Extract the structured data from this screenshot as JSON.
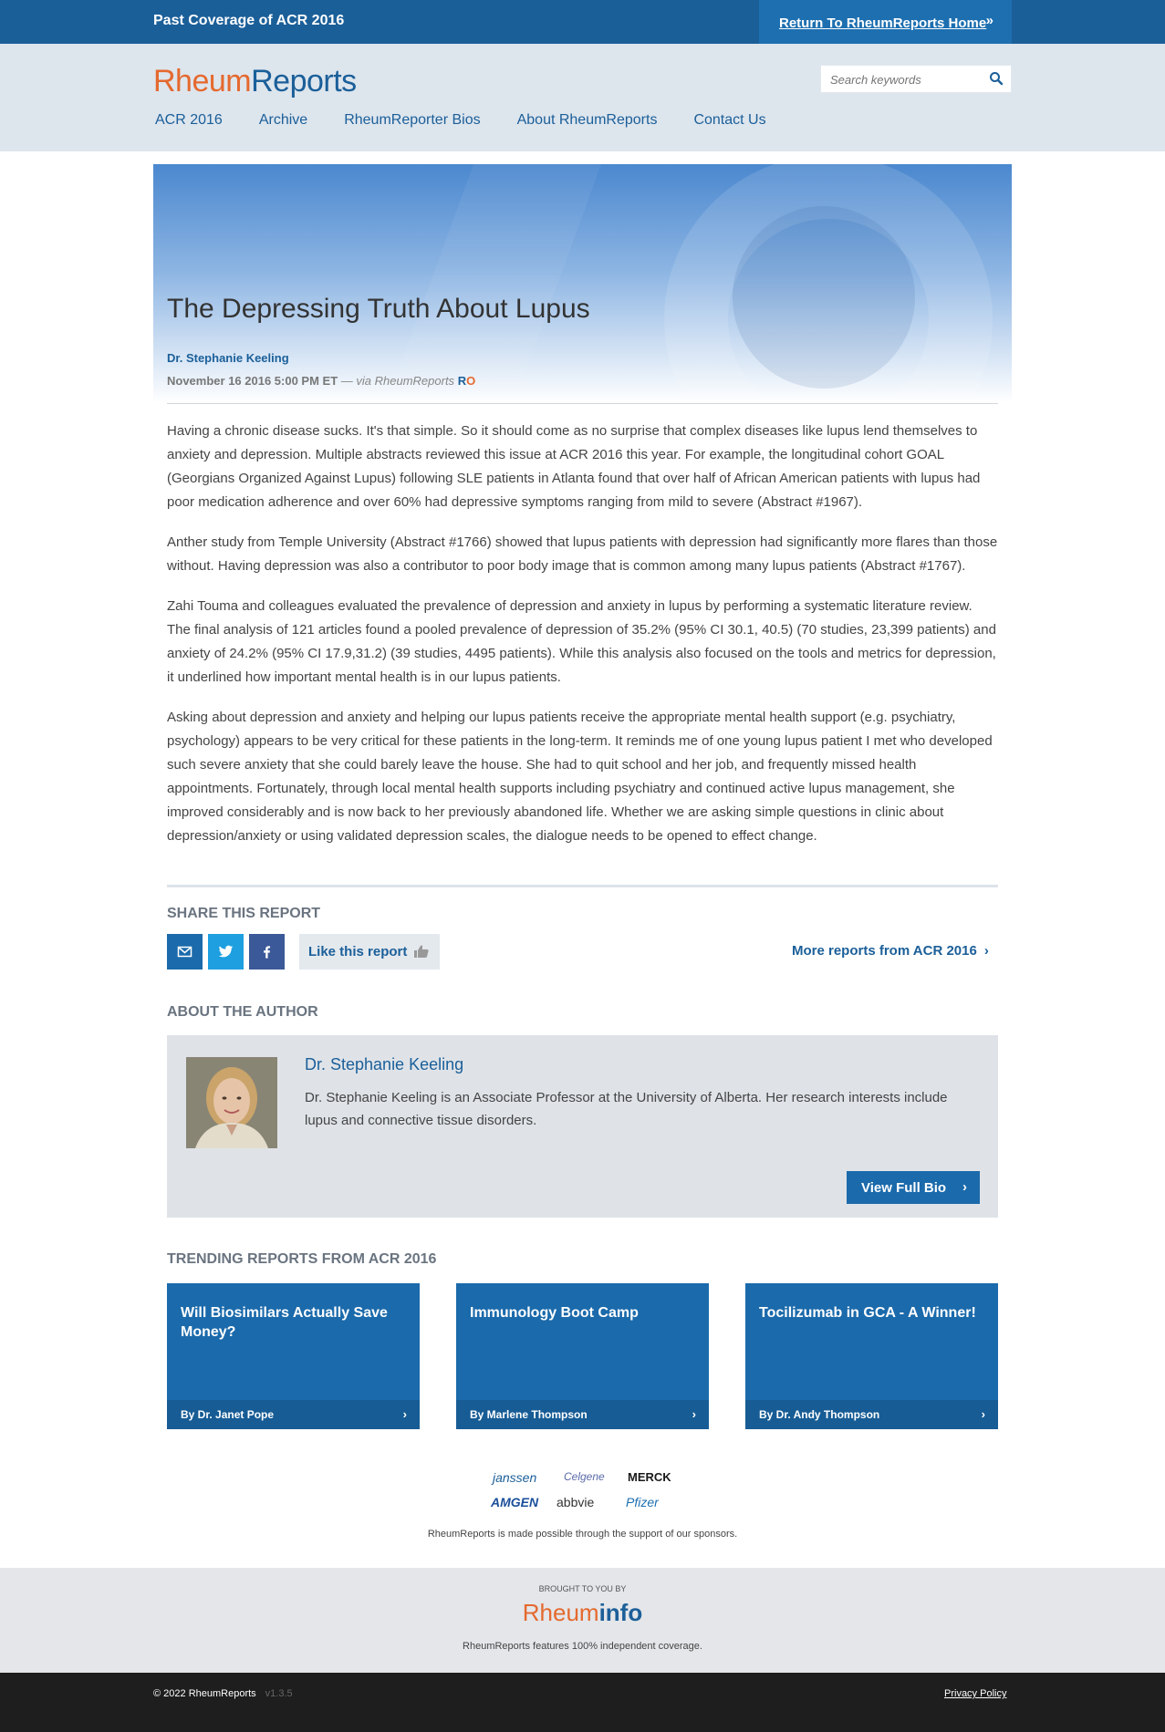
{
  "topbar": {
    "title": "Past Coverage of ACR 2016",
    "return_label": "Return To RheumReports Home",
    "return_icon": "double-chevron-right-icon"
  },
  "header": {
    "logo_part1": "Rheum",
    "logo_part2": "Reports",
    "search_placeholder": "Search keywords",
    "nav": [
      "ACR 2016",
      "Archive",
      "RheumReporter Bios",
      "About RheumReports",
      "Contact Us"
    ]
  },
  "article": {
    "title": "The Depressing Truth About Lupus",
    "author": "Dr. Stephanie Keeling",
    "date": "November 16 2016 5:00 PM ET",
    "via": "— via RheumReports",
    "badge_r": "R",
    "badge_o": "O",
    "paragraphs": [
      "Having a chronic disease sucks. It's that simple. So it should come as no surprise that complex diseases like lupus lend themselves to anxiety and depression. Multiple abstracts reviewed this issue at ACR 2016 this year. For example, the longitudinal cohort GOAL (Georgians Organized Against Lupus) following SLE patients in Atlanta found that over half of African American patients with lupus had poor medication adherence and over 60% had depressive symptoms ranging from mild to severe (Abstract #1967).",
      "Anther study from Temple University (Abstract #1766) showed that lupus patients with depression had significantly more flares than those without. Having depression was also a contributor to poor body image that is common among many lupus patients (Abstract #1767).",
      "Zahi Touma and colleagues evaluated the prevalence of depression and anxiety in lupus by performing a systematic literature review. The final analysis of 121 articles found a pooled prevalence of depression of 35.2% (95% CI 30.1, 40.5) (70 studies, 23,399 patients) and anxiety of 24.2% (95% CI 17.9,31.2) (39 studies, 4495 patients). While this analysis also focused on the tools and metrics for depression, it underlined how important mental health is in our lupus patients.",
      "Asking about depression and anxiety and helping our lupus patients receive the appropriate mental health support (e.g. psychiatry, psychology) appears to be very critical for these patients in the long-term. It reminds me of one young lupus patient I met who developed such severe anxiety that she could barely leave the house. She had to quit school and her job, and frequently missed health appointments. Fortunately, through local mental health supports including psychiatry and continued active lupus management, she improved considerably and is now back to her previously abandoned life. Whether we are asking simple questions in clinic about depression/anxiety or using validated depression scales, the dialogue needs to be opened to effect change."
    ]
  },
  "share": {
    "heading": "SHARE THIS REPORT",
    "like_label": "Like this report",
    "more_label": "More reports from ACR 2016"
  },
  "about": {
    "heading": "ABOUT THE AUTHOR",
    "name": "Dr. Stephanie Keeling",
    "bio": "Dr. Stephanie Keeling is an Associate Professor at the University of Alberta. Her research interests include lupus and connective tissue disorders.",
    "button": "View Full Bio"
  },
  "trending": {
    "heading": "TRENDING REPORTS FROM ACR 2016",
    "cards": [
      {
        "title": "Will Biosimilars Actually Save Money?",
        "by": "By Dr. Janet Pope"
      },
      {
        "title": "Immunology Boot Camp",
        "by": "By Marlene Thompson"
      },
      {
        "title": "Tocilizumab in GCA - A Winner!",
        "by": "By Dr. Andy Thompson"
      }
    ]
  },
  "sponsors": {
    "names": [
      "janssen",
      "Celgene",
      "MERCK",
      "AMGEN",
      "abbvie",
      "Pfizer"
    ],
    "note": "RheumReports is made possible through the support of our sponsors."
  },
  "brought": {
    "label": "BROUGHT TO YOU BY",
    "logo_part1": "Rheum",
    "logo_part2": "info",
    "note": "RheumReports features 100% independent coverage."
  },
  "footer": {
    "copyright": "© 2022 RheumReports",
    "version": "v1.3.5",
    "privacy": "Privacy Policy"
  },
  "colors": {
    "brand_blue": "#1b5f99",
    "brand_orange": "#e5692e",
    "header_bg": "#dde5ed"
  }
}
